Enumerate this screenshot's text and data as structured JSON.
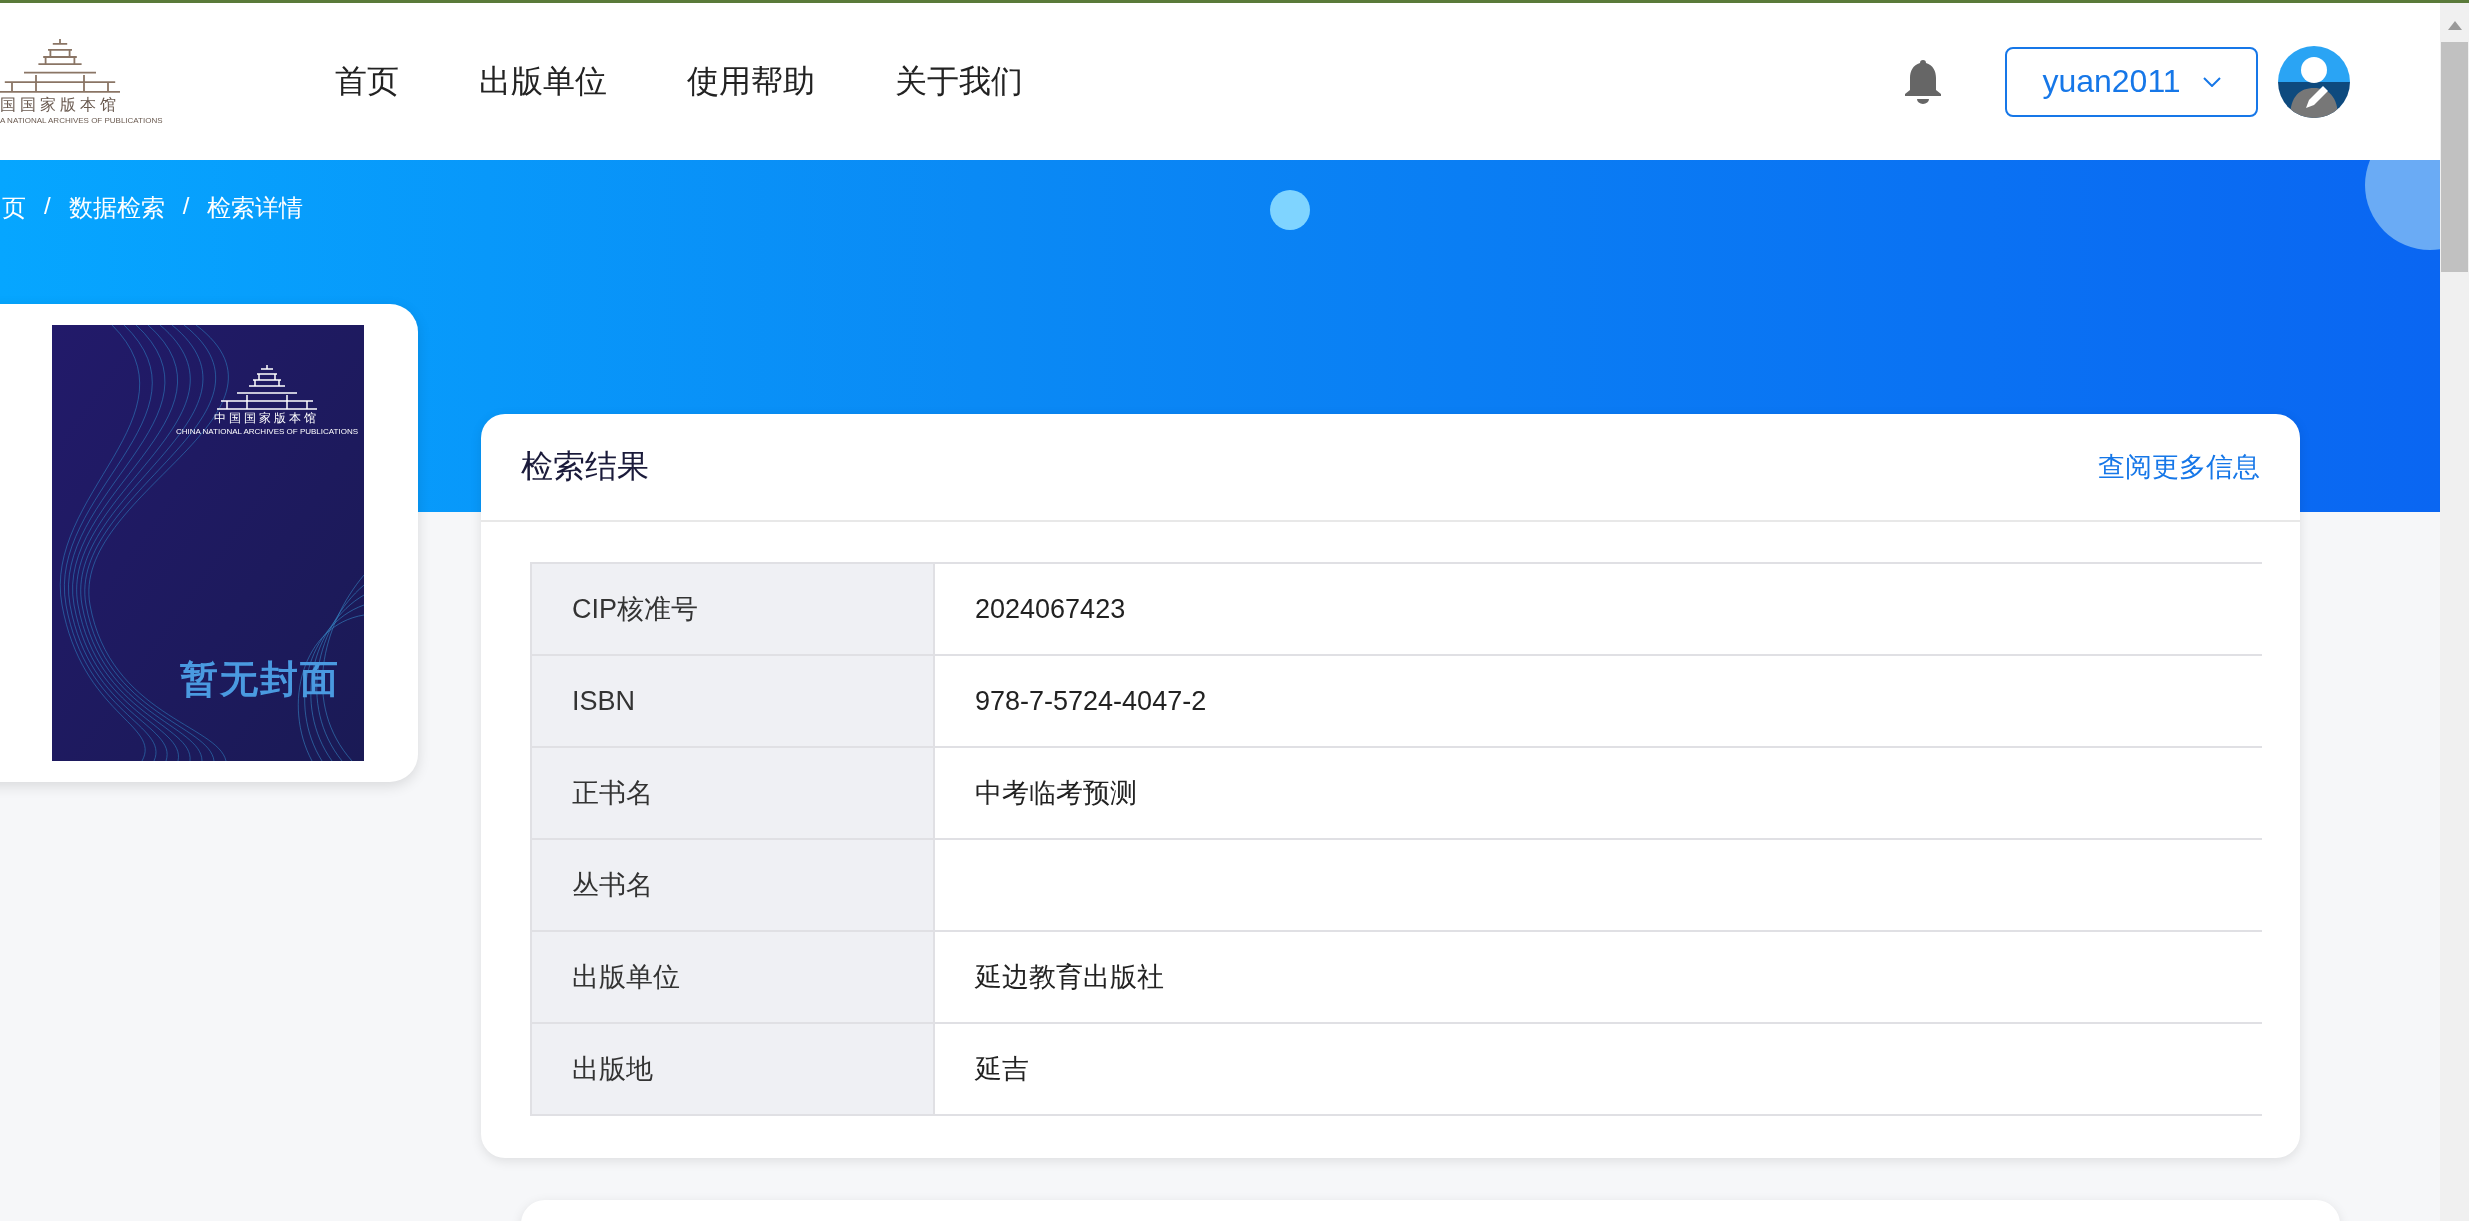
{
  "header": {
    "logo": {
      "name": "国国家版本馆",
      "subtitle": "A NATIONAL ARCHIVES OF PUBLICATIONS"
    },
    "nav": [
      {
        "label": "首页"
      },
      {
        "label": "出版单位"
      },
      {
        "label": "使用帮助"
      },
      {
        "label": "关于我们"
      }
    ],
    "user": {
      "name": "yuan2011"
    }
  },
  "breadcrumb": {
    "separator": "/",
    "items": [
      "页",
      "数据检索",
      "检索详情"
    ]
  },
  "cover": {
    "logo_name": "中国国家版本馆",
    "logo_subtitle": "CHINA NATIONAL ARCHIVES OF PUBLICATIONS",
    "caption": "暂无封面"
  },
  "result": {
    "title": "检索结果",
    "more_link": "查阅更多信息",
    "rows": [
      {
        "label": "CIP核准号",
        "value": "2024067423"
      },
      {
        "label": "ISBN",
        "value": "978-7-5724-4047-2"
      },
      {
        "label": "正书名",
        "value": "中考临考预测"
      },
      {
        "label": "丛书名"
      },
      {
        "label": "出版单位",
        "value": "延边教育出版社"
      },
      {
        "label": "出版地",
        "value": "延吉"
      }
    ]
  }
}
